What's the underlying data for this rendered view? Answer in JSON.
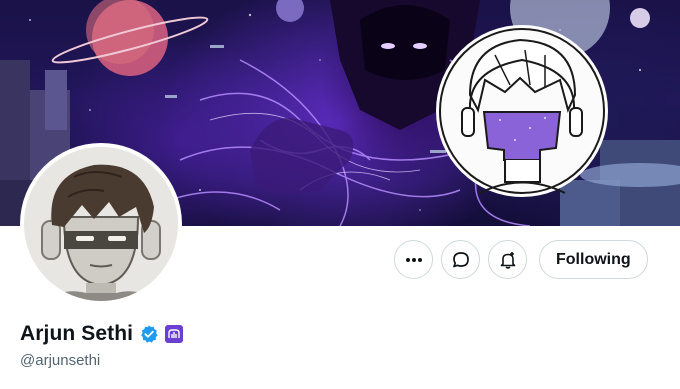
{
  "profile": {
    "display_name": "Arjun Sethi",
    "handle": "@arjunsethi",
    "verified": true,
    "affiliation_badge": "purple-square-badge-icon"
  },
  "actions": {
    "more_icon": "more-horizontal-icon",
    "message_icon": "message-bubble-icon",
    "notify_icon": "bell-plus-icon",
    "follow_label": "Following"
  },
  "colors": {
    "verified_blue": "#1d9bf0",
    "affiliation_purple": "#6b3fd4",
    "handle_gray": "#536471",
    "text_dark": "#0f1419",
    "border": "#cfd9de"
  }
}
